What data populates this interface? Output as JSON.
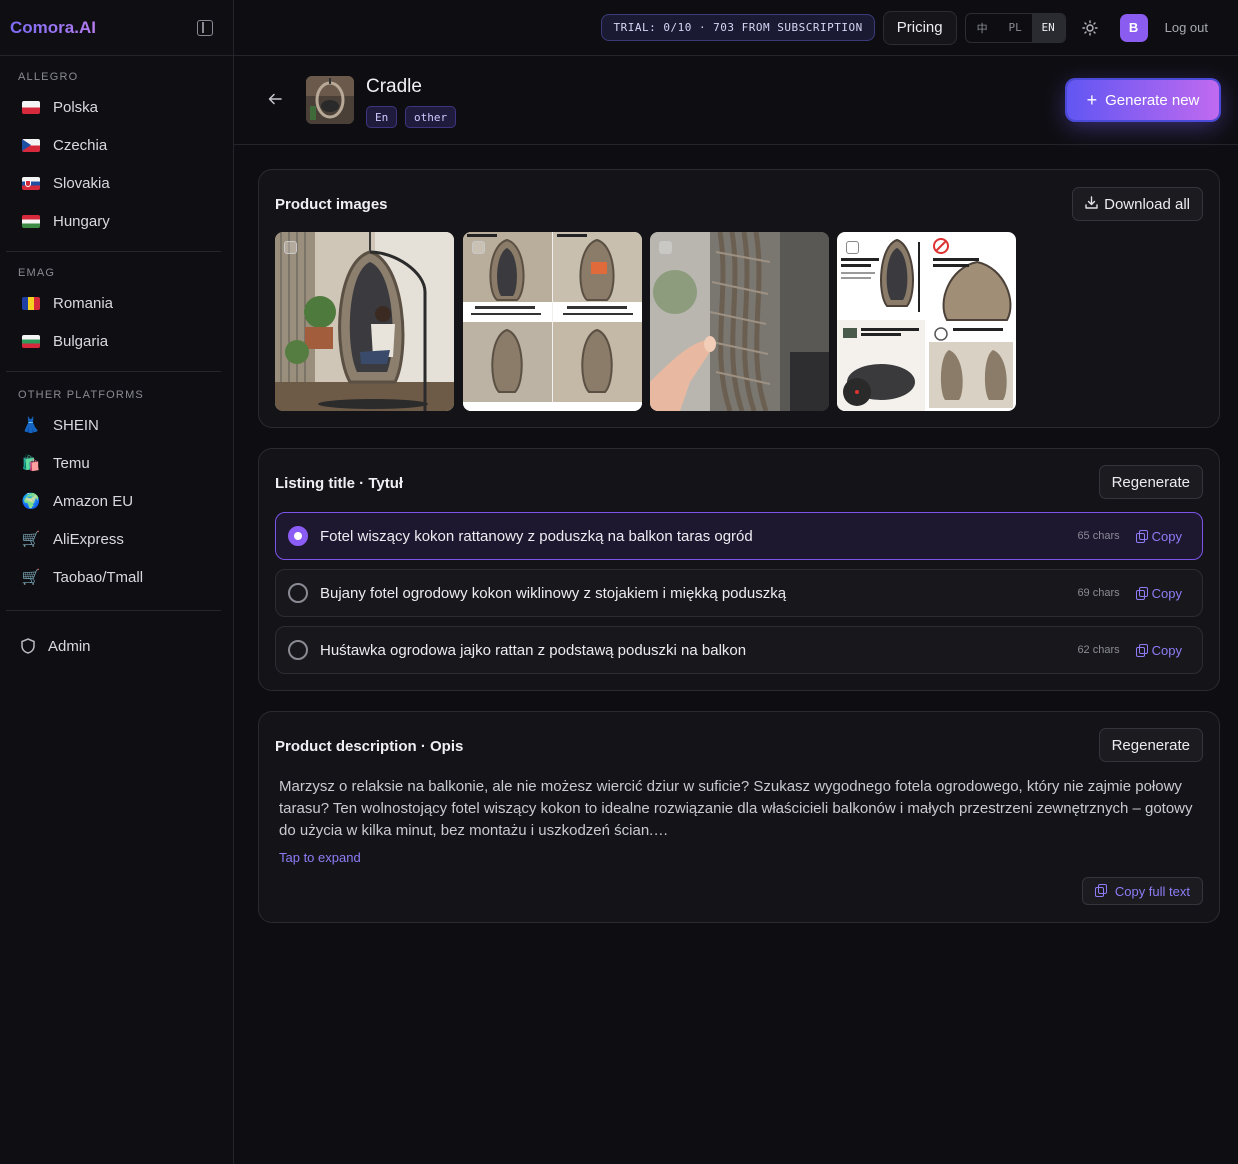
{
  "app": {
    "brand": "Comora.AI"
  },
  "sidebar": {
    "sections": [
      {
        "label": "ALLEGRO",
        "items": [
          {
            "label": "Polska",
            "icon": "flag-poland-icon"
          },
          {
            "label": "Czechia",
            "icon": "flag-czechia-icon"
          },
          {
            "label": "Slovakia",
            "icon": "flag-slovakia-icon"
          },
          {
            "label": "Hungary",
            "icon": "flag-hungary-icon"
          }
        ]
      },
      {
        "label": "EMAG",
        "items": [
          {
            "label": "Romania",
            "icon": "flag-romania-icon"
          },
          {
            "label": "Bulgaria",
            "icon": "flag-bulgaria-icon"
          }
        ]
      },
      {
        "label": "OTHER PLATFORMS",
        "items": [
          {
            "label": "SHEIN",
            "icon": "dress-icon",
            "glyph": "👗"
          },
          {
            "label": "Temu",
            "icon": "shopping-bags-icon",
            "glyph": "🛍️"
          },
          {
            "label": "Amazon EU",
            "icon": "globe-icon",
            "glyph": "🌍"
          },
          {
            "label": "AliExpress",
            "icon": "cart-icon",
            "glyph": "🛒"
          },
          {
            "label": "Taobao/Tmall",
            "icon": "cart-icon",
            "glyph": "🛒"
          }
        ]
      }
    ],
    "admin": {
      "label": "Admin",
      "icon": "shield-icon"
    }
  },
  "topbar": {
    "trial": "TRIAL: 0/10 · 703 FROM SUBSCRIPTION",
    "pricing": "Pricing",
    "languages": [
      {
        "label": "中",
        "active": false
      },
      {
        "label": "PL",
        "active": false
      },
      {
        "label": "EN",
        "active": true
      }
    ],
    "avatar_initial": "B",
    "logout": "Log out"
  },
  "product": {
    "title": "Cradle",
    "tags": [
      "En",
      "other"
    ],
    "generate_label": "Generate new"
  },
  "images_card": {
    "title": "Product images",
    "download_label": "Download all",
    "images": [
      {
        "name": "product-image-1",
        "selected": false
      },
      {
        "name": "product-image-2",
        "selected": false
      },
      {
        "name": "product-image-3",
        "selected": false
      },
      {
        "name": "product-image-4",
        "selected": false
      }
    ]
  },
  "title_card": {
    "title": "Listing title · Tytuł",
    "regenerate_label": "Regenerate",
    "options": [
      {
        "text": "Fotel wiszący kokon rattanowy z poduszką na balkon taras ogród",
        "chars": "65 chars",
        "copy": "Copy",
        "selected": true
      },
      {
        "text": "Bujany fotel ogrodowy kokon wiklinowy z stojakiem i miękką poduszką",
        "chars": "69 chars",
        "copy": "Copy",
        "selected": false
      },
      {
        "text": "Huśtawka ogrodowa jajko rattan z podstawą poduszki na balkon",
        "chars": "62 chars",
        "copy": "Copy",
        "selected": false
      }
    ]
  },
  "desc_card": {
    "title": "Product description · Opis",
    "regenerate_label": "Regenerate",
    "text": "Marzysz o relaksie na balkonie, ale nie możesz wiercić dziur w suficie? Szukasz wygodnego fotela ogrodowego, który nie zajmie połowy tarasu? Ten wolnostojący fotel wiszący kokon to idealne rozwiązanie dla właścicieli balkonów i małych przestrzeni zewnętrznych – gotowy do użycia w kilka minut, bez montażu i uszkodzeń ścian.…",
    "expand_label": "Tap to expand",
    "copy_full_label": "Copy full text"
  },
  "colors": {
    "accent": "#8b5cf6",
    "accent_gradient_start": "#6156f2",
    "accent_gradient_end": "#c06af0",
    "background": "#0e0e12"
  }
}
